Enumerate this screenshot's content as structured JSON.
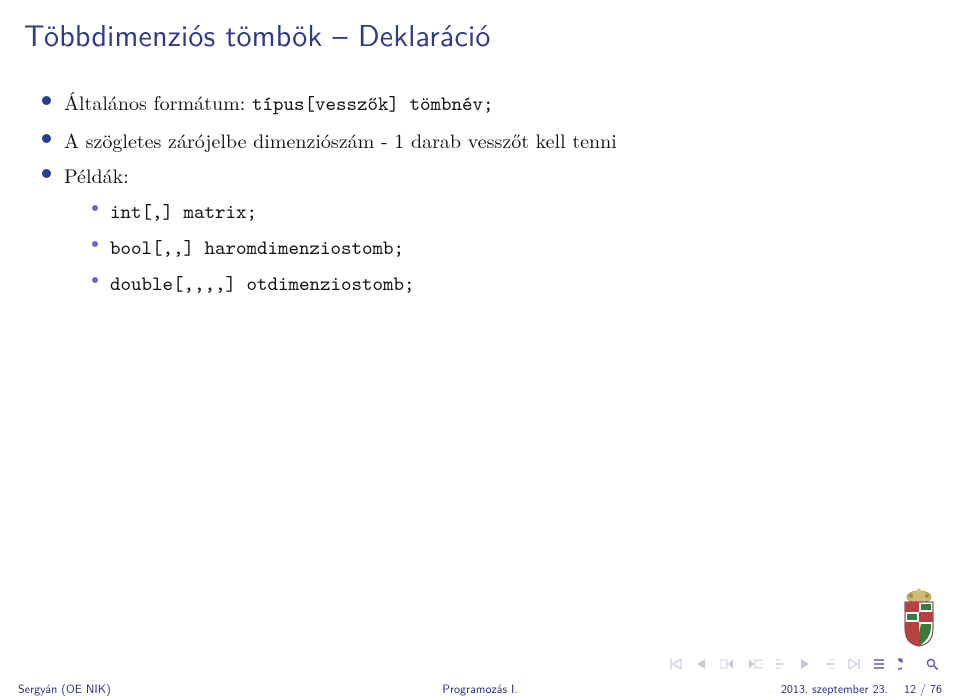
{
  "title": "Többdimenziós tömbök – Deklaráció",
  "bullets": {
    "b0_pre": "Általános formátum: ",
    "b0_code": "típus[vesszők] tömbnév;",
    "b1": "A szögletes zárójelbe dimenziószám - 1 darab vesszőt kell tenni",
    "b2": "Példák:",
    "examples": {
      "e0": "int[,] matrix;",
      "e1": "bool[,,] haromdimenziostomb;",
      "e2": "double[,,,,] otdimenziostomb;"
    }
  },
  "footer": {
    "author": "Sergyán (OE NIK)",
    "title": "Programozás I.",
    "date": "2013. szeptember 23.",
    "page": "12 / 76"
  }
}
